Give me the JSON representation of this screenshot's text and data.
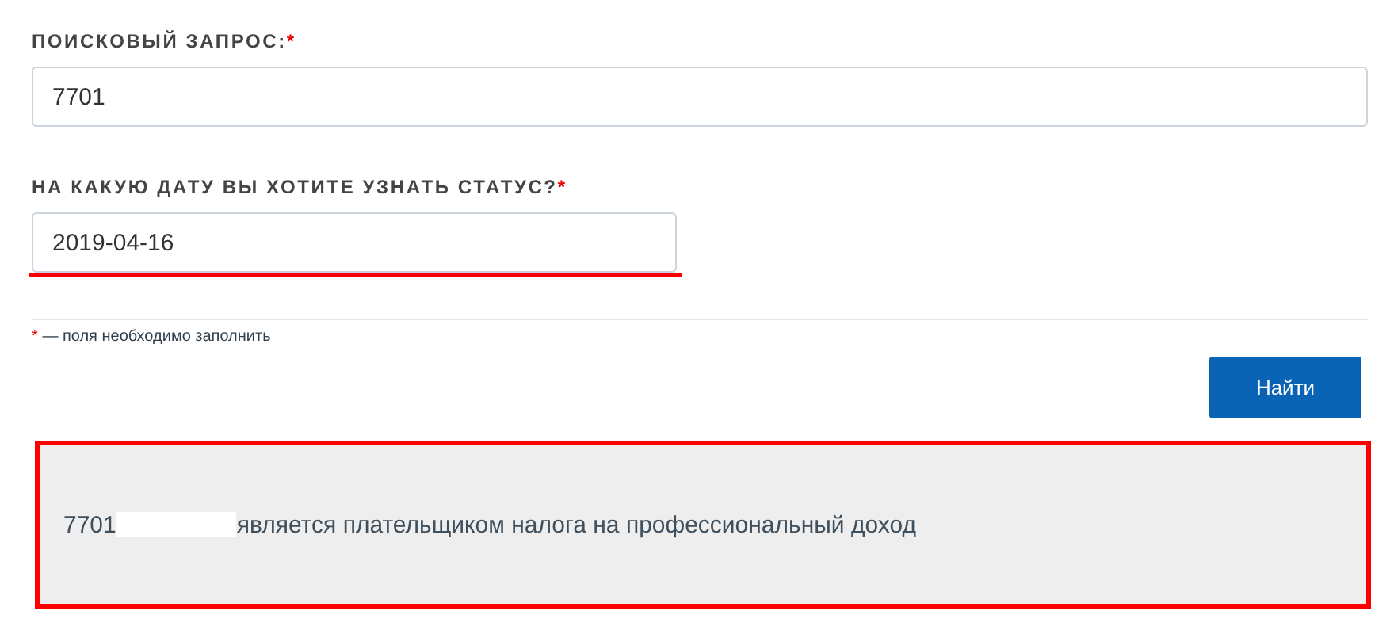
{
  "fields": [
    {
      "label": "ПОИСКОВЫЙ ЗАПРОС:",
      "required_mark": "*",
      "value": "7701",
      "kind": "wide",
      "annotated": false
    },
    {
      "label": "НА КАКУЮ ДАТУ ВЫ ХОТИТЕ УЗНАТЬ СТАТУС?",
      "required_mark": "*",
      "value": "2019-04-16",
      "kind": "narrow",
      "annotated": true
    }
  ],
  "note": {
    "mark": "*",
    "text": "— поля необходимо заполнить"
  },
  "button": "Найти",
  "result": {
    "prefix": "7701",
    "redacted": true,
    "text": "является плательщиком налога на профессиональный доход",
    "annotated": true
  }
}
